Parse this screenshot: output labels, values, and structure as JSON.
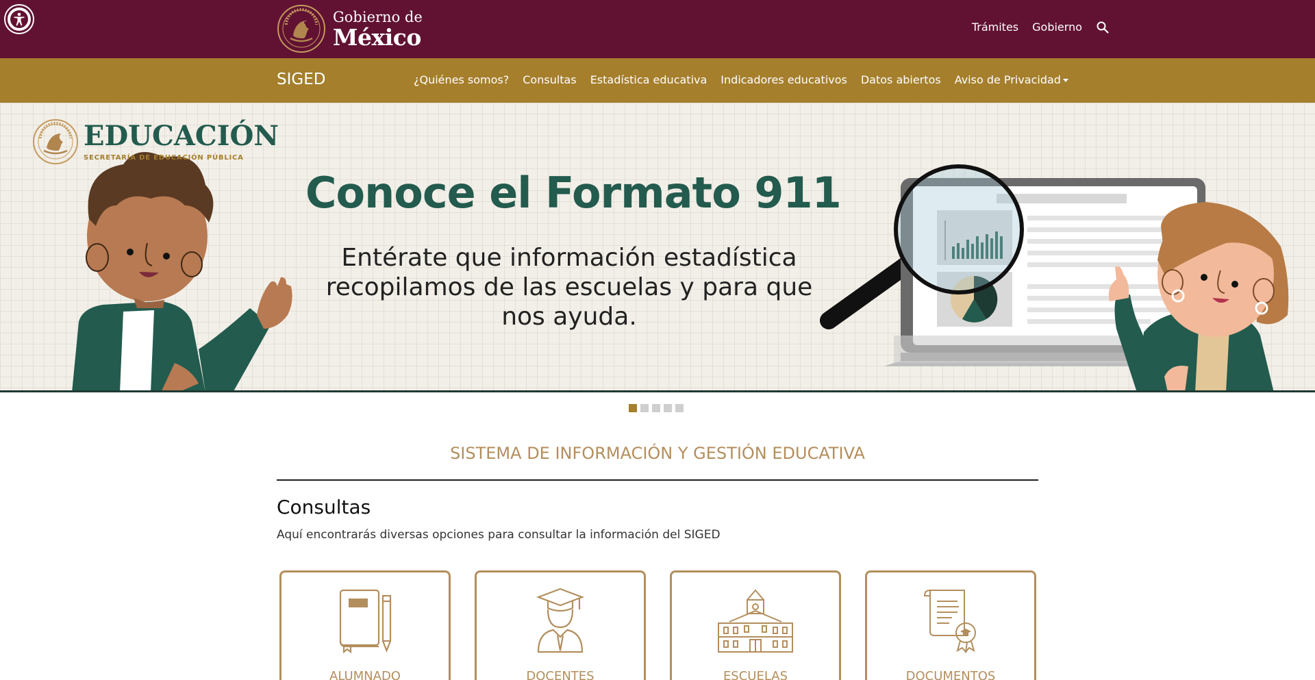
{
  "header": {
    "logo_line1": "Gobierno de",
    "logo_line2": "México",
    "links": [
      "Trámites",
      "Gobierno"
    ]
  },
  "nav": {
    "brand": "SIGED",
    "items": [
      "¿Quiénes somos?",
      "Consultas",
      "Estadística educativa",
      "Indicadores educativos",
      "Datos abiertos",
      "Aviso de Privacidad"
    ]
  },
  "hero": {
    "logo_title": "EDUCACIÓN",
    "logo_subtitle": "SECRETARÍA DE EDUCACIÓN PÚBLICA",
    "title": "Conoce el Formato 911",
    "subtitle": "Entérate que información estadística recopilamos de las escuelas y para que nos ayuda.",
    "slide_count": 5,
    "active_slide": 1
  },
  "section": {
    "title": "SISTEMA DE INFORMACIÓN Y GESTIÓN EDUCATIVA",
    "heading": "Consultas",
    "description": "Aquí encontrarás diversas opciones para consultar la información del SIGED"
  },
  "cards": [
    {
      "label": "ALUMNADO",
      "icon": "notebook-pencil-icon"
    },
    {
      "label": "DOCENTES",
      "icon": "graduate-teacher-icon"
    },
    {
      "label": "ESCUELAS",
      "icon": "school-building-icon"
    },
    {
      "label": "DOCUMENTOS",
      "icon": "certificate-document-icon"
    }
  ],
  "colors": {
    "gov_bar": "#611232",
    "siged_bar": "#a57f2c",
    "accent_gold": "#b38e5d",
    "hero_green": "#235b4e"
  }
}
